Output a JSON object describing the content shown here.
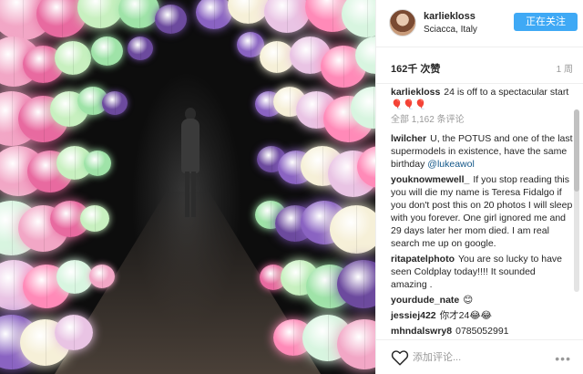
{
  "post": {
    "username": "karliekloss",
    "location": "Sciacca, Italy",
    "follow_label": "正在关注",
    "likes": "162千 次赞",
    "time_ago": "1 周",
    "caption_author": "karliekloss",
    "caption_text": "24 is off to a spectacular start 🎈🎈🎈",
    "view_all": "全部 1,162 条评论"
  },
  "comments": [
    {
      "author": "lwilcher",
      "text": "U, the POTUS and one of the last supermodels in existence, have the same birthday",
      "mention": "@lukeawol"
    },
    {
      "author": "youknowmewell_",
      "text": "If you stop reading this you will die my name is Teresa Fidalgo if you don't post this on 20 photos I will sleep with you forever. One girl ignored me and 29 days later her mom died. I am real search me up on google.",
      "mention": ""
    },
    {
      "author": "ritapatelphoto",
      "text": "You are so lucky to have seen Coldplay today!!!! It sounded amazing .",
      "mention": ""
    },
    {
      "author": "yourdude_nate",
      "text": "😊",
      "mention": ""
    },
    {
      "author": "jessiej422",
      "text": "你才24😂😂",
      "mention": ""
    },
    {
      "author": "mhndalswry8",
      "text": "0785052991",
      "mention": ""
    }
  ],
  "footer": {
    "comment_placeholder": "添加评论...",
    "heart_icon": "heart-outline-icon",
    "more_icon": "more-dots-icon"
  },
  "colors": {
    "follow_button": "#3fa9f5",
    "mention": "#125688"
  }
}
